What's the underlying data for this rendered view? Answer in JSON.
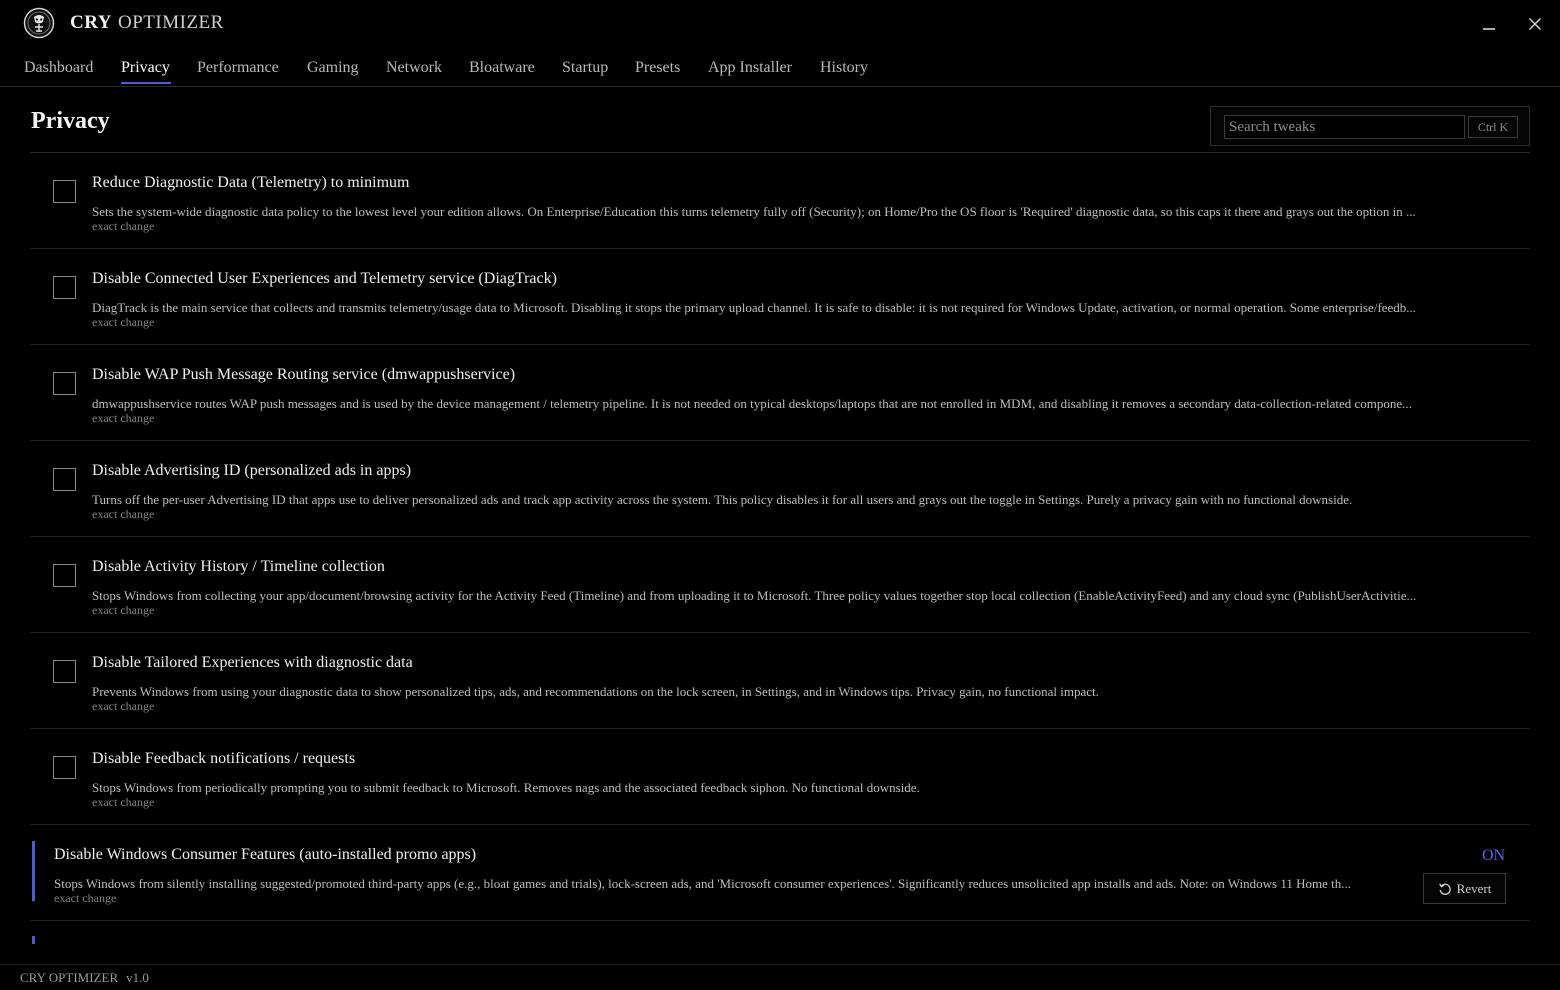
{
  "app": {
    "title_bold": "CRY",
    "title_rest": "OPTIMIZER"
  },
  "window": {
    "minimize_icon": "minimize-icon",
    "close_icon": "close-icon"
  },
  "tabs": [
    {
      "label": "Dashboard"
    },
    {
      "label": "Privacy",
      "active": true
    },
    {
      "label": "Performance"
    },
    {
      "label": "Gaming"
    },
    {
      "label": "Network"
    },
    {
      "label": "Bloatware"
    },
    {
      "label": "Startup"
    },
    {
      "label": "Presets"
    },
    {
      "label": "App Installer"
    },
    {
      "label": "History"
    }
  ],
  "page": {
    "title": "Privacy",
    "search_placeholder": "Search tweaks",
    "search_shortcut": "Ctrl K"
  },
  "tweaks": [
    {
      "title": "Reduce Diagnostic Data (Telemetry) to minimum",
      "description": "Sets the system-wide diagnostic data policy to the lowest level your edition allows. On Enterprise/Education this turns telemetry fully off (Security); on Home/Pro the OS floor is 'Required' diagnostic data, so this caps it there and grays out the option in ...",
      "meta": "exact change",
      "enabled": false
    },
    {
      "title": "Disable Connected User Experiences and Telemetry service (DiagTrack)",
      "description": "DiagTrack is the main service that collects and transmits telemetry/usage data to Microsoft. Disabling it stops the primary upload channel. It is safe to disable: it is not required for Windows Update, activation, or normal operation. Some enterprise/feedb...",
      "meta": "exact change",
      "enabled": false
    },
    {
      "title": "Disable WAP Push Message Routing service (dmwappushservice)",
      "description": "dmwappushservice routes WAP push messages and is used by the device management / telemetry pipeline. It is not needed on typical desktops/laptops that are not enrolled in MDM, and disabling it removes a secondary data-collection-related compone...",
      "meta": "exact change",
      "enabled": false
    },
    {
      "title": "Disable Advertising ID (personalized ads in apps)",
      "description": "Turns off the per-user Advertising ID that apps use to deliver personalized ads and track app activity across the system. This policy disables it for all users and grays out the toggle in Settings. Purely a privacy gain with no functional downside.",
      "meta": "exact change",
      "enabled": false
    },
    {
      "title": "Disable Activity History / Timeline collection",
      "description": "Stops Windows from collecting your app/document/browsing activity for the Activity Feed (Timeline) and from uploading it to Microsoft. Three policy values together stop local collection (EnableActivityFeed) and any cloud sync (PublishUserActivitie...",
      "meta": "exact change",
      "enabled": false
    },
    {
      "title": "Disable Tailored Experiences with diagnostic data",
      "description": "Prevents Windows from using your diagnostic data to show personalized tips, ads, and recommendations on the lock screen, in Settings, and in Windows tips. Privacy gain, no functional impact.",
      "meta": "exact change",
      "enabled": false
    },
    {
      "title": "Disable Feedback notifications / requests",
      "description": "Stops Windows from periodically prompting you to submit feedback to Microsoft. Removes nags and the associated feedback siphon. No functional downside.",
      "meta": "exact change",
      "enabled": false
    },
    {
      "title": "Disable Windows Consumer Features (auto-installed promo apps)",
      "description": "Stops Windows from silently installing suggested/promoted third-party apps (e.g., bloat games and trials), lock-screen ads, and 'Microsoft consumer experiences'. Significantly reduces unsolicited app installs and ads. Note: on Windows 11 Home th...",
      "meta": "exact change",
      "enabled": true,
      "status_label": "ON",
      "revert_label": "Revert"
    }
  ],
  "colors": {
    "accent": "#5865f2",
    "background": "#000000"
  },
  "footer": {
    "app_name": "CRY OPTIMIZER",
    "version": "v1.0"
  }
}
